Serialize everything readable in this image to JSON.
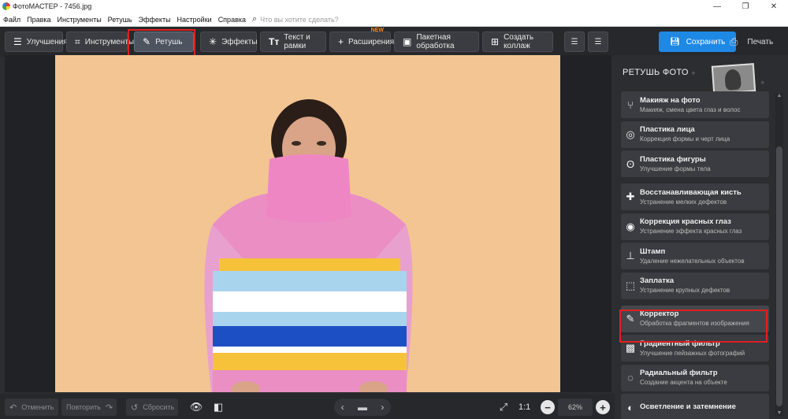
{
  "window": {
    "title": "ФотоМАСТЕР - 7456.jpg",
    "controls": [
      "—",
      "❐",
      "✕"
    ]
  },
  "menu": {
    "items": [
      "Файл",
      "Правка",
      "Инструменты",
      "Ретушь",
      "Эффекты",
      "Настройки",
      "Справка"
    ],
    "search_placeholder": "Что вы хотите сделать?"
  },
  "toolbar": {
    "tabs": [
      {
        "label": "Улучшения",
        "icon": "sliders-icon"
      },
      {
        "label": "Инструменты",
        "icon": "crop-icon"
      },
      {
        "label": "Ретушь",
        "icon": "brush-icon"
      },
      {
        "label": "Эффекты",
        "icon": "magic-wand-icon"
      },
      {
        "label": "Текст и рамки",
        "icon": "text-icon"
      },
      {
        "label": "Расширения",
        "icon": "plus-icon",
        "badge": "NEW"
      },
      {
        "label": "Пакетная обработка",
        "icon": "image-stack-icon"
      },
      {
        "label": "Создать коллаж",
        "icon": "collage-icon"
      }
    ],
    "save_label": "Сохранить",
    "print_label": "Печать"
  },
  "bottom": {
    "undo_label": "Отменить",
    "redo_label": "Повторить",
    "reset_label": "Сбросить",
    "zoom_ratio": "1:1",
    "zoom_value": "62%"
  },
  "panel": {
    "title": "РЕТУШЬ ФОТО",
    "items": [
      {
        "name": "Макияж на фото",
        "desc": "Макияж, смена цвета глаз и волос"
      },
      {
        "name": "Пластика лица",
        "desc": "Коррекция формы и черт лица"
      },
      {
        "name": "Пластика фигуры",
        "desc": "Улучшение формы тела"
      },
      {
        "name": "Восстанавливающая кисть",
        "desc": "Устранение мелких дефектов"
      },
      {
        "name": "Коррекция красных глаз",
        "desc": "Устранение эффекта красных глаз"
      },
      {
        "name": "Штамп",
        "desc": "Удаление нежелательных объектов"
      },
      {
        "name": "Заплатка",
        "desc": "Устранение крупных дефектов"
      },
      {
        "name": "Корректор",
        "desc": "Обработка фрагментов изображения"
      },
      {
        "name": "Градиентный фильтр",
        "desc": "Улучшение пейзажных фотографий"
      },
      {
        "name": "Радиальный фильтр",
        "desc": "Создание акцента на объекте"
      },
      {
        "name": "Осветление и затемнение",
        "desc": ""
      }
    ]
  },
  "colors": {
    "accent": "#1e88e5",
    "highlight": "#e02020",
    "background": "#f2c592"
  }
}
